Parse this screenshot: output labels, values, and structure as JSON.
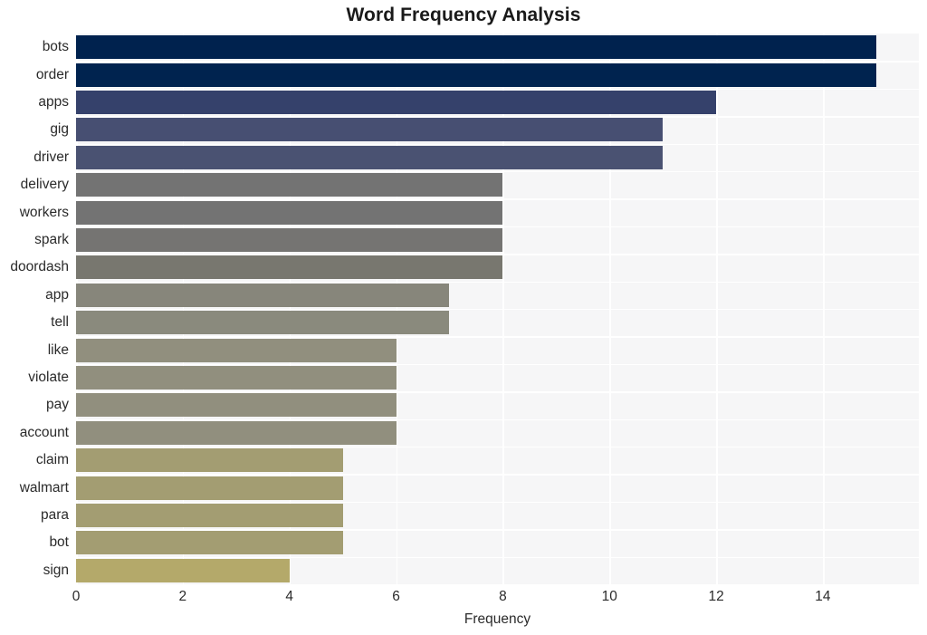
{
  "chart_data": {
    "type": "bar",
    "orientation": "horizontal",
    "title": "Word Frequency Analysis",
    "xlabel": "Frequency",
    "ylabel": "",
    "categories": [
      "bots",
      "order",
      "apps",
      "gig",
      "driver",
      "delivery",
      "workers",
      "spark",
      "doordash",
      "app",
      "tell",
      "like",
      "violate",
      "pay",
      "account",
      "claim",
      "walmart",
      "para",
      "bot",
      "sign"
    ],
    "values": [
      15,
      15,
      12,
      11,
      11,
      8,
      8,
      8,
      8,
      7,
      7,
      6,
      6,
      6,
      6,
      5,
      5,
      5,
      5,
      4
    ],
    "bar_colors": [
      "#00224e",
      "#00234f",
      "#35416b",
      "#474f72",
      "#4a5272",
      "#737373",
      "#737373",
      "#757472",
      "#78776f",
      "#87867b",
      "#8a8a7d",
      "#918f7e",
      "#918f7e",
      "#918f7e",
      "#918f7e",
      "#a39d72",
      "#a39d72",
      "#a39d72",
      "#a39d72",
      "#b4a96a"
    ],
    "xlim": [
      0,
      15.8
    ],
    "xticks": [
      0,
      2,
      4,
      6,
      8,
      10,
      12,
      14
    ],
    "xtick_labels": [
      "0",
      "2",
      "4",
      "6",
      "8",
      "10",
      "12",
      "14"
    ],
    "grid": true,
    "grid_color": "#ffffff",
    "plot_background": "#f6f6f7",
    "figure_background": "#ffffff",
    "title_color": "#1a1a1a",
    "tick_color": "#2b2b2b",
    "legend": null
  }
}
